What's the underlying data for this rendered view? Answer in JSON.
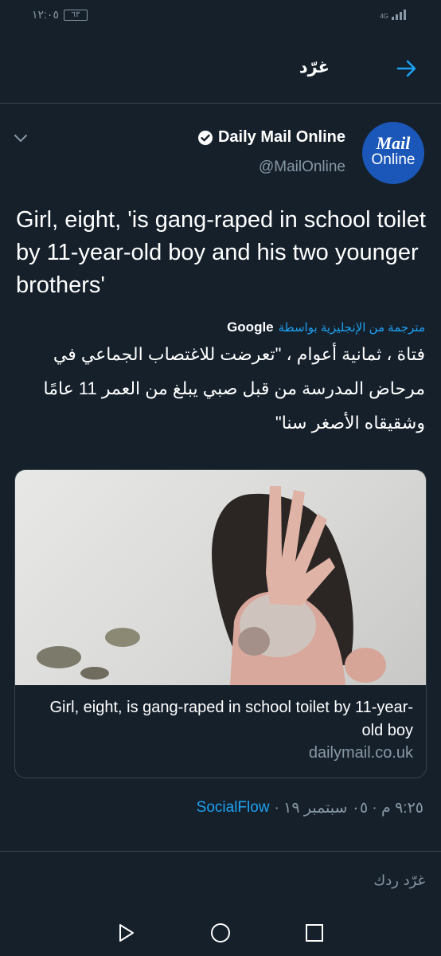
{
  "status_bar": {
    "time": "١٢:٠٥",
    "battery": "٦٣",
    "network": "4G"
  },
  "header": {
    "title": "غرّد",
    "back_icon": "arrow-right-icon"
  },
  "tweet": {
    "display_name": "Daily Mail Online",
    "handle": "@MailOnline",
    "avatar_text_1": "Mail",
    "avatar_text_2": "Online",
    "text": "Girl, eight, 'is gang-raped in school toilet by 11-year-old boy and his two younger brothers'",
    "translated_by": "مترجمة من الإنجليزية بواسطة",
    "translator": "Google",
    "translated_text": "فتاة ، ثمانية أعوام ، \"تعرضت للاغتصاب الجماعي في مرحاض المدرسة من قبل صبي يبلغ من العمر 11 عامًا وشقيقاه الأصغر سنا\"",
    "card": {
      "title": "Girl, eight, is gang-raped in school toilet by 11-year-old boy",
      "domain": "dailymail.co.uk"
    },
    "timestamp": "٩:٢٥ م · ٠٥ سبتمبر ١٩ ·",
    "source": "SocialFlow"
  },
  "reply": {
    "placeholder": "غرّد ردك"
  },
  "colors": {
    "background": "#15202b",
    "accent": "#1da1f2",
    "secondary_text": "#8899a6",
    "border": "#38444d"
  }
}
